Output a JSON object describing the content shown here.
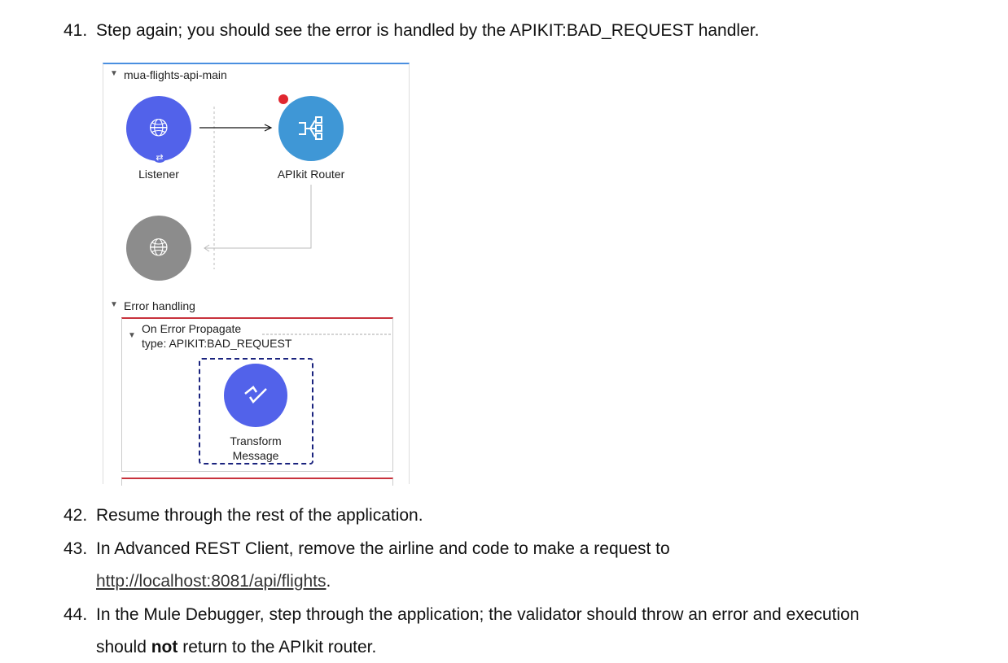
{
  "steps": [
    {
      "num": "41.",
      "text": "Step again; you should see the error is handled by the APIKIT:BAD_REQUEST handler."
    },
    {
      "num": "42.",
      "text": "Resume through the rest of the application."
    },
    {
      "num": "43.",
      "text": "In Advanced REST Client, remove the airline and code to make a request to",
      "link": "http://localhost:8081/api/flights",
      "after": "."
    },
    {
      "num": "44.",
      "text": "In the Mule Debugger, step through the application; the validator should throw an error and execution",
      "line2_pre": "should ",
      "line2_bold": "not",
      "line2_post": " return to the APIkit router."
    }
  ],
  "diagram": {
    "flow_name": "mua-flights-api-main",
    "listener_label": "Listener",
    "router_label": "APIkit Router",
    "error_section": "Error handling",
    "on_error_title": "On Error Propagate",
    "on_error_type": "type: APIKIT:BAD_REQUEST",
    "transform_label_1": "Transform",
    "transform_label_2": "Message",
    "colors": {
      "listener": "#5262ea",
      "router": "#3f97d6",
      "response": "#8c8c8c",
      "breakpoint": "#e0262f",
      "error_border": "#c8323c",
      "selection": "#1a237e"
    }
  }
}
